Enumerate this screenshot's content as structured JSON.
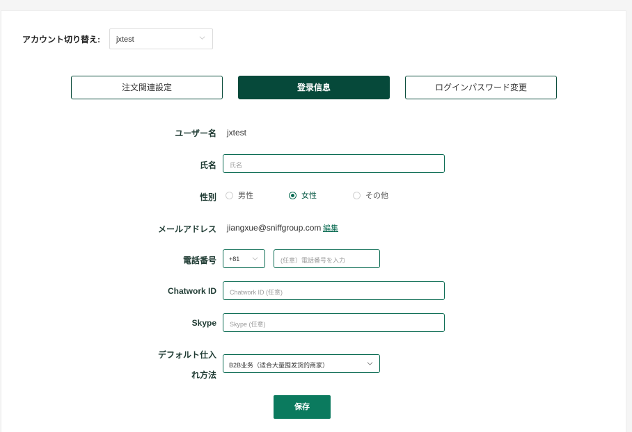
{
  "account_switch": {
    "label": "アカウント切り替え:",
    "selected": "jxtest"
  },
  "tabs": [
    {
      "label": "注文関連設定",
      "active": false
    },
    {
      "label": "登录信息",
      "active": true
    },
    {
      "label": "ログインパスワード変更",
      "active": false
    }
  ],
  "form": {
    "username": {
      "label": "ユーザー名",
      "value": "jxtest"
    },
    "name": {
      "label": "氏名",
      "placeholder": "氏名"
    },
    "gender": {
      "label": "性別",
      "options": [
        "男性",
        "女性",
        "その他"
      ],
      "selected": "女性"
    },
    "email": {
      "label": "メールアドレス",
      "value": "jiangxue@sniffgroup.com",
      "edit_label": "編集"
    },
    "phone": {
      "label": "電話番号",
      "country_code": "+81",
      "placeholder": "(任意）電話番号を入力"
    },
    "chatwork": {
      "label": "Chatwork ID",
      "placeholder": "Chatwork ID (任意)"
    },
    "skype": {
      "label": "Skype",
      "placeholder": "Skype (任意)"
    },
    "purchase_method": {
      "label_line1": "デフォルト仕入",
      "label_line2": "れ方法",
      "value": "B2B业务（适合大量囤发货的商家）"
    }
  },
  "save_label": "保存",
  "colors": {
    "primary_dark": "#06493a",
    "primary": "#0b7a5e",
    "border_green": "#0a6b52"
  }
}
